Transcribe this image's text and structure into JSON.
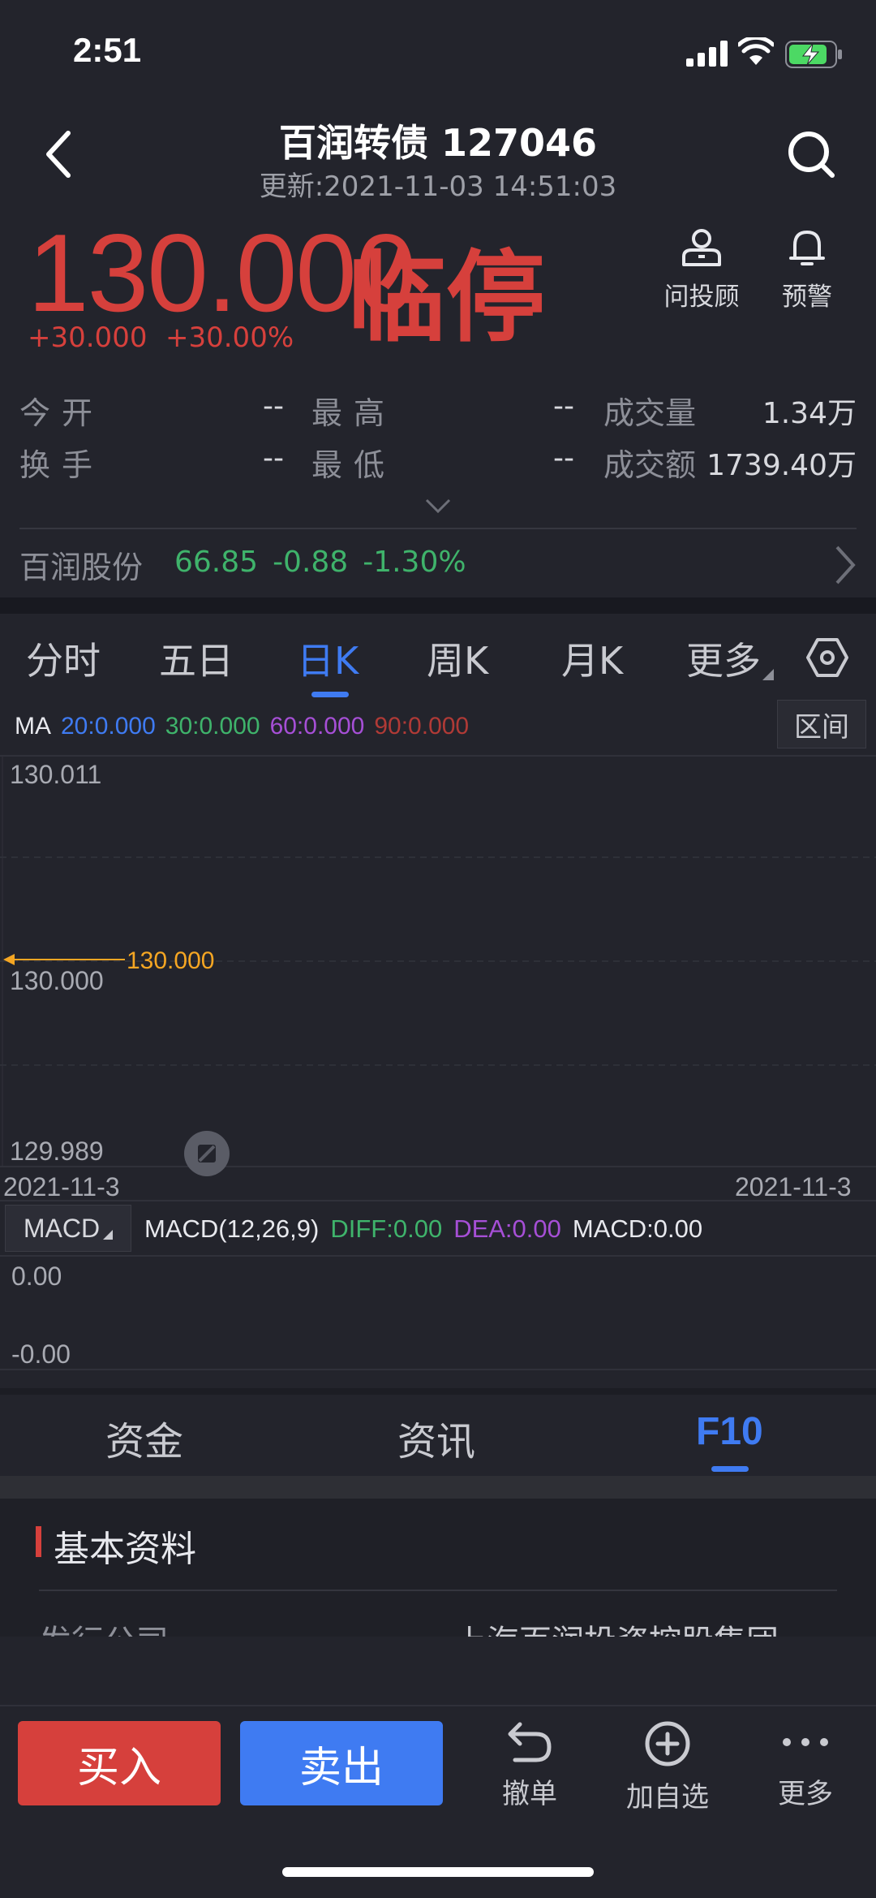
{
  "status_bar": {
    "time": "2:51"
  },
  "header": {
    "title": "百润转债 127046",
    "subtitle": "更新:2021-11-03 14:51:03"
  },
  "quote": {
    "price": "130.000",
    "status_tag": "临停",
    "change_abs": "+30.000",
    "change_pct": "+30.00%",
    "color_up": "#d6403c"
  },
  "actions": [
    {
      "label": "问投顾",
      "icon": "advisor-icon"
    },
    {
      "label": "预警",
      "icon": "bell-icon"
    }
  ],
  "stats": {
    "open_label": "今开",
    "open_value": "--",
    "high_label": "最高",
    "high_value": "--",
    "volume_label": "成交量",
    "volume_value": "1.34万",
    "turnover_label": "换手",
    "turnover_value": "--",
    "low_label": "最低",
    "low_value": "--",
    "amount_label": "成交额",
    "amount_value": "1739.40万"
  },
  "related": {
    "name": "百润股份",
    "price": "66.85",
    "change": "-0.88",
    "pct": "-1.30%",
    "color_down": "#3fb36b"
  },
  "kline_tabs": [
    "分时",
    "五日",
    "日K",
    "周K",
    "月K",
    "更多"
  ],
  "kline_active": "日K",
  "ma": {
    "label": "MA",
    "ma20": "20:0.000",
    "ma30": "30:0.000",
    "ma60": "60:0.000",
    "ma90": "90:0.000",
    "colors": {
      "ma20": "#3f7bf2",
      "ma30": "#3fb36b",
      "ma60": "#a64fd6",
      "ma90": "#b03a36"
    }
  },
  "interval_button": "区间",
  "chart_data": {
    "type": "line",
    "x": [
      "2021-11-3"
    ],
    "series": [
      {
        "values": [
          130.0
        ]
      }
    ],
    "ylim": [
      129.989,
      130.011
    ],
    "y_ticks": [
      "130.011",
      "130.000",
      "129.989"
    ],
    "current_price_marker": "130.000",
    "x_start_label": "2021-11-3",
    "x_end_label": "2021-11-3",
    "grid": true
  },
  "macd": {
    "button_label": "MACD",
    "params": "MACD(12,26,9)",
    "diff": "DIFF:0.00",
    "dea": "DEA:0.00",
    "macd_value": "MACD:0.00",
    "y_top": "0.00",
    "y_bottom": "-0.00",
    "colors": {
      "diff": "#3fb36b",
      "dea": "#a64fd6"
    }
  },
  "bottom_tabs": [
    "资金",
    "资讯",
    "F10"
  ],
  "bottom_active": "F10",
  "card": {
    "title": "基本资料",
    "row_label": "发行公司",
    "row_value": "上海百润投资控股集团"
  },
  "trade": {
    "buy": "买入",
    "sell": "卖出",
    "tools": [
      {
        "label": "撤单",
        "icon": "undo-icon"
      },
      {
        "label": "加自选",
        "icon": "add-watchlist-icon"
      },
      {
        "label": "更多",
        "icon": "more-icon"
      }
    ]
  }
}
